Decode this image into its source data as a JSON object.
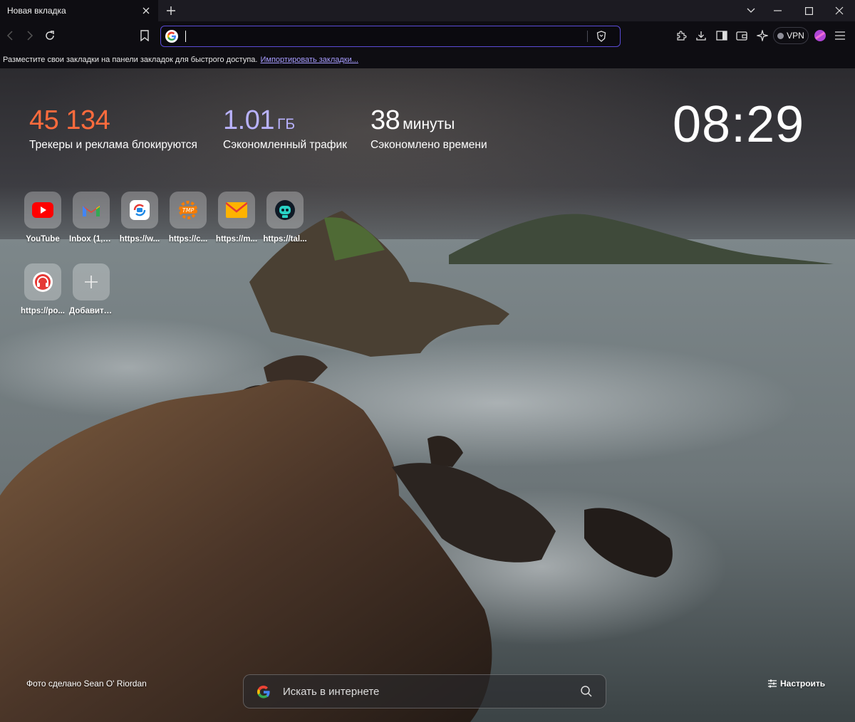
{
  "tab": {
    "title": "Новая вкладка"
  },
  "toolbar": {
    "omnibox_value": "",
    "vpn_label": "VPN"
  },
  "bookmarks_bar": {
    "prompt": "Разместите свои закладки на панели закладок для быстрого доступа.",
    "import_link": "Импортировать закладки..."
  },
  "stats": {
    "trackers": {
      "value": "45 134",
      "label": "Трекеры и реклама блокируются",
      "color": "#ff6b3d"
    },
    "bandwidth": {
      "value": "1.01",
      "unit": "ГБ",
      "label": "Сэкономленный трафик",
      "color": "#b9b2ff"
    },
    "time": {
      "value": "38",
      "unit": "минуты",
      "label": "Сэкономлено времени",
      "color": "#ffffff"
    }
  },
  "clock": "08:29",
  "top_sites": [
    {
      "label": "YouTube",
      "icon": "youtube-icon"
    },
    {
      "label": "Inbox (1,7...",
      "icon": "gmail-icon"
    },
    {
      "label": "https://w...",
      "icon": "sync-chat-icon"
    },
    {
      "label": "https://c...",
      "icon": "tmp-logo-icon"
    },
    {
      "label": "https://m...",
      "icon": "mail-envelope-icon"
    },
    {
      "label": "https://tal...",
      "icon": "robot-icon"
    },
    {
      "label": "https://po...",
      "icon": "headphones-icon"
    },
    {
      "label": "Добавить...",
      "icon": "plus-icon"
    }
  ],
  "photo_credit": "Фото сделано Sean O' Riordan",
  "search": {
    "placeholder": "Искать в интернете"
  },
  "customize_label": "Настроить"
}
